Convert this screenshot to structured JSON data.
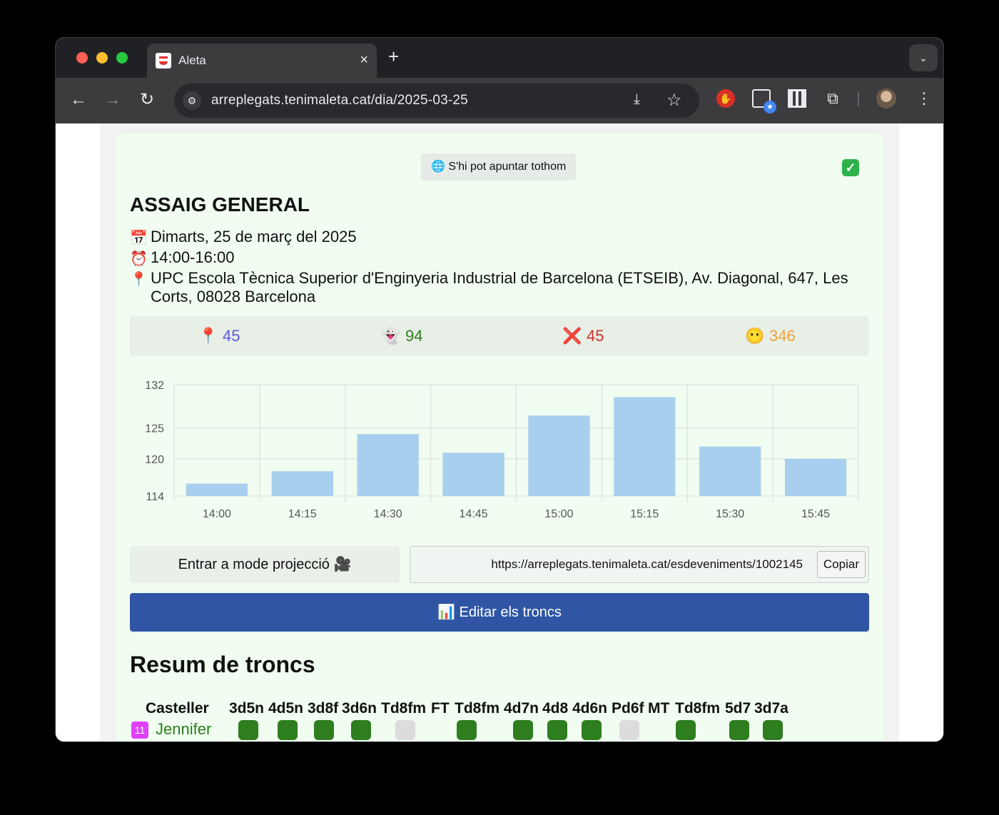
{
  "browser": {
    "tab_title": "Aleta",
    "tab_close": "×",
    "new_tab": "+",
    "url": "arreplegats.tenimaleta.cat/dia/2025-03-25"
  },
  "event": {
    "badge": "🌐 S'hi pot apuntar tothom",
    "check": "✓",
    "title": "ASSAIG GENERAL",
    "date": "Dimarts, 25 de març del 2025",
    "time": "14:00-16:00",
    "place": "UPC Escola Tècnica Superior d'Enginyeria Industrial de Barcelona (ETSEIB), Av. Diagonal, 647, Les Corts, 08028 Barcelona",
    "icons": {
      "date": "calendar-icon",
      "time": "alarm-clock-icon",
      "place": "pin-icon"
    }
  },
  "stats": [
    {
      "icon": "pin-icon",
      "glyph": "📍",
      "value": "45",
      "color": "#5b5bd6"
    },
    {
      "icon": "ghost-icon",
      "glyph": "👻",
      "value": "94",
      "color": "#2e7d1f"
    },
    {
      "icon": "cross-icon",
      "glyph": "❌",
      "value": "45",
      "color": "#d32f2f"
    },
    {
      "icon": "neutral-face-icon",
      "glyph": "😶",
      "value": "346",
      "color": "#f2a03a"
    }
  ],
  "chart_data": {
    "type": "bar",
    "categories": [
      "14:00",
      "14:15",
      "14:30",
      "14:45",
      "15:00",
      "15:15",
      "15:30",
      "15:45"
    ],
    "values": [
      116,
      118,
      124,
      121,
      127,
      130,
      122,
      120
    ],
    "yticks": [
      114,
      120,
      125,
      132
    ],
    "ylim": [
      114,
      132
    ],
    "bar_color": "#a8cfee",
    "grid": true
  },
  "actions": {
    "projection": "Entrar a mode projecció 🎥",
    "share_url": "https://arreplegats.tenimaleta.cat/esdeveniments/1002145",
    "copy": "Copiar",
    "edit": "📊 Editar els troncs"
  },
  "summary": {
    "title": "Resum de troncs",
    "columns": [
      "Casteller",
      "3d5n",
      "4d5n",
      "3d8f",
      "3d6n",
      "Td8fm",
      "FT",
      "Td8fm",
      "4d7n",
      "4d8",
      "4d6n",
      "Pd6f",
      "MT",
      "Td8fm",
      "5d7",
      "3d7a"
    ],
    "member": {
      "badge": "11",
      "name": "Jennifer"
    },
    "cells": [
      true,
      true,
      true,
      true,
      false,
      true,
      true,
      true,
      true,
      false,
      true,
      true,
      true
    ]
  }
}
